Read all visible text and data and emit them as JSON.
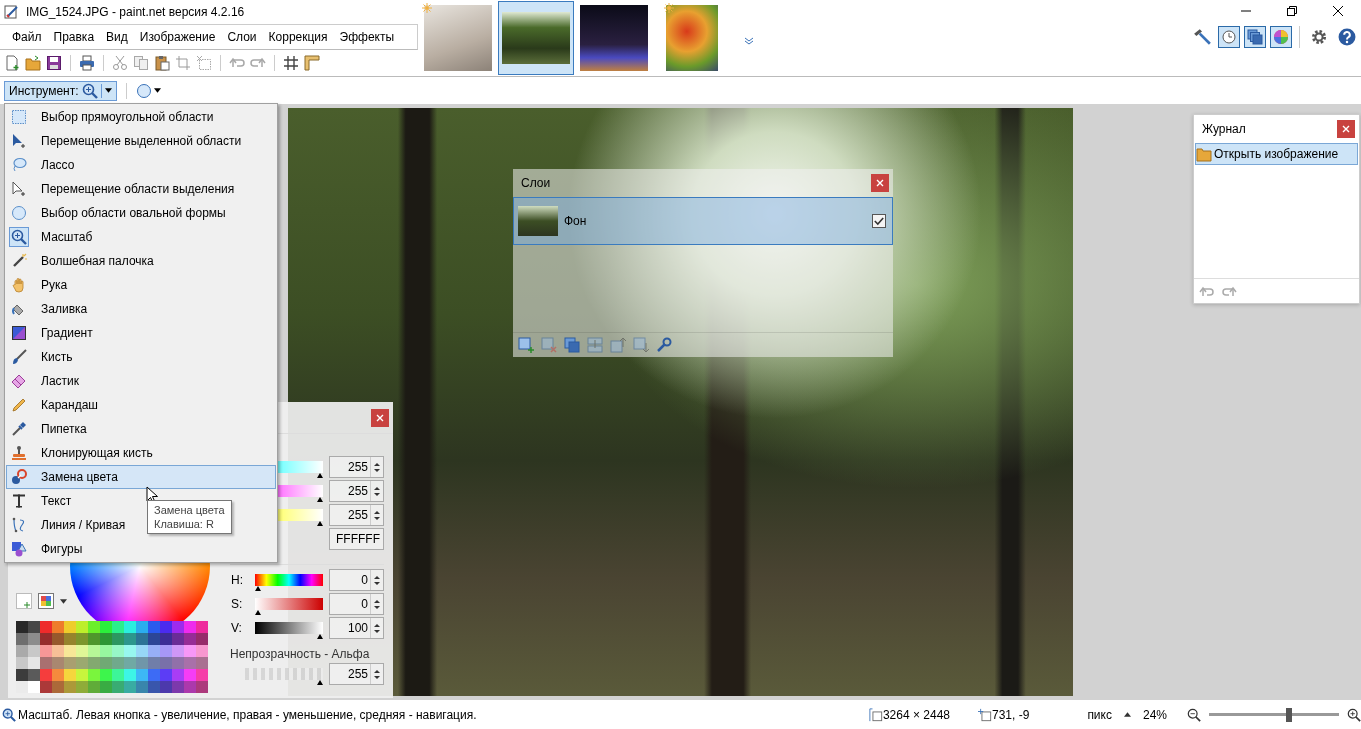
{
  "window": {
    "title": "IMG_1524.JPG - paint.net версия 4.2.16"
  },
  "menu": [
    "Файл",
    "Правка",
    "Вид",
    "Изображение",
    "Слои",
    "Коррекция",
    "Эффекты"
  ],
  "images": [
    {
      "kind": "interior",
      "selected": false,
      "modified": true
    },
    {
      "kind": "forest",
      "selected": true,
      "modified": false
    },
    {
      "kind": "night",
      "selected": false,
      "modified": false
    },
    {
      "kind": "peppers",
      "selected": false,
      "modified": true
    }
  ],
  "panel_toggles": [
    {
      "kind": "history",
      "on": true
    },
    {
      "kind": "layers",
      "on": true
    },
    {
      "kind": "colors",
      "on": true
    }
  ],
  "tool_button": {
    "label": "Инструмент:"
  },
  "tools": [
    {
      "kind": "rectselect",
      "label": "Выбор прямоугольной области",
      "selected": false,
      "highlighted": false
    },
    {
      "kind": "moveselected",
      "label": "Перемещение выделенной области",
      "selected": false,
      "highlighted": false
    },
    {
      "kind": "lasso",
      "label": "Лассо",
      "selected": false,
      "highlighted": false
    },
    {
      "kind": "moveselection",
      "label": "Перемещение области выделения",
      "selected": false,
      "highlighted": false
    },
    {
      "kind": "ellipse",
      "label": "Выбор области овальной формы",
      "selected": false,
      "highlighted": false
    },
    {
      "kind": "zoom",
      "label": "Масштаб",
      "selected": true,
      "highlighted": false
    },
    {
      "kind": "wand",
      "label": "Волшебная палочка",
      "selected": false,
      "highlighted": false
    },
    {
      "kind": "hand",
      "label": "Рука",
      "selected": false,
      "highlighted": false
    },
    {
      "kind": "fill",
      "label": "Заливка",
      "selected": false,
      "highlighted": false
    },
    {
      "kind": "gradient",
      "label": "Градиент",
      "selected": false,
      "highlighted": false
    },
    {
      "kind": "brush",
      "label": "Кисть",
      "selected": false,
      "highlighted": false
    },
    {
      "kind": "eraser",
      "label": "Ластик",
      "selected": false,
      "highlighted": false
    },
    {
      "kind": "pencil",
      "label": "Карандаш",
      "selected": false,
      "highlighted": false
    },
    {
      "kind": "picker",
      "label": "Пипетка",
      "selected": false,
      "highlighted": false
    },
    {
      "kind": "clone",
      "label": "Клонирующая кисть",
      "selected": false,
      "highlighted": false
    },
    {
      "kind": "recolor",
      "label": "Замена цвета",
      "selected": false,
      "highlighted": true
    },
    {
      "kind": "text",
      "label": "Текст",
      "selected": false,
      "highlighted": false
    },
    {
      "kind": "line",
      "label": "Линия / Кривая",
      "selected": false,
      "highlighted": false
    },
    {
      "kind": "shapes",
      "label": "Фигуры",
      "selected": false,
      "highlighted": false
    }
  ],
  "tooltip": {
    "title": "Замена цвета",
    "shortcut": "Клавиша: R"
  },
  "layers": {
    "title": "Слои",
    "items": [
      {
        "name": "Фон",
        "selected": true,
        "visible": true
      }
    ],
    "buttons": [
      {
        "kind": "add",
        "disabled": false
      },
      {
        "kind": "delete",
        "disabled": true
      },
      {
        "kind": "duplicate",
        "disabled": false
      },
      {
        "kind": "merge",
        "disabled": true
      },
      {
        "kind": "up",
        "disabled": true
      },
      {
        "kind": "down",
        "disabled": true
      },
      {
        "kind": "properties",
        "disabled": false
      }
    ]
  },
  "history": {
    "title": "Журнал",
    "items": [
      {
        "label": "Открыть изображение",
        "selected": true
      }
    ]
  },
  "colors": {
    "rgb": [
      {
        "kind": "red",
        "value": "255",
        "level": 1
      },
      {
        "kind": "green",
        "value": "255",
        "level": 1
      },
      {
        "kind": "blue",
        "value": "255",
        "level": 1
      }
    ],
    "hex": "FFFFFF",
    "hsv": [
      {
        "kind": "hue",
        "label": "H:",
        "value": "0",
        "level": 0
      },
      {
        "kind": "saturation",
        "label": "S:",
        "value": "0",
        "level": 0
      },
      {
        "kind": "value",
        "label": "V:",
        "value": "100",
        "level": 1
      }
    ],
    "alpha": {
      "label": "Непрозрачность - Альфа",
      "value": "255",
      "level": 1
    }
  },
  "status": {
    "message": "Масштаб. Левая кнопка - увеличение, правая - уменьшение, средняя - навигация.",
    "size": "3264 × 2448",
    "cursor": "731, -9",
    "units": "пикс",
    "zoom": "24%",
    "zoom_slider": {
      "level": 0.62
    }
  }
}
